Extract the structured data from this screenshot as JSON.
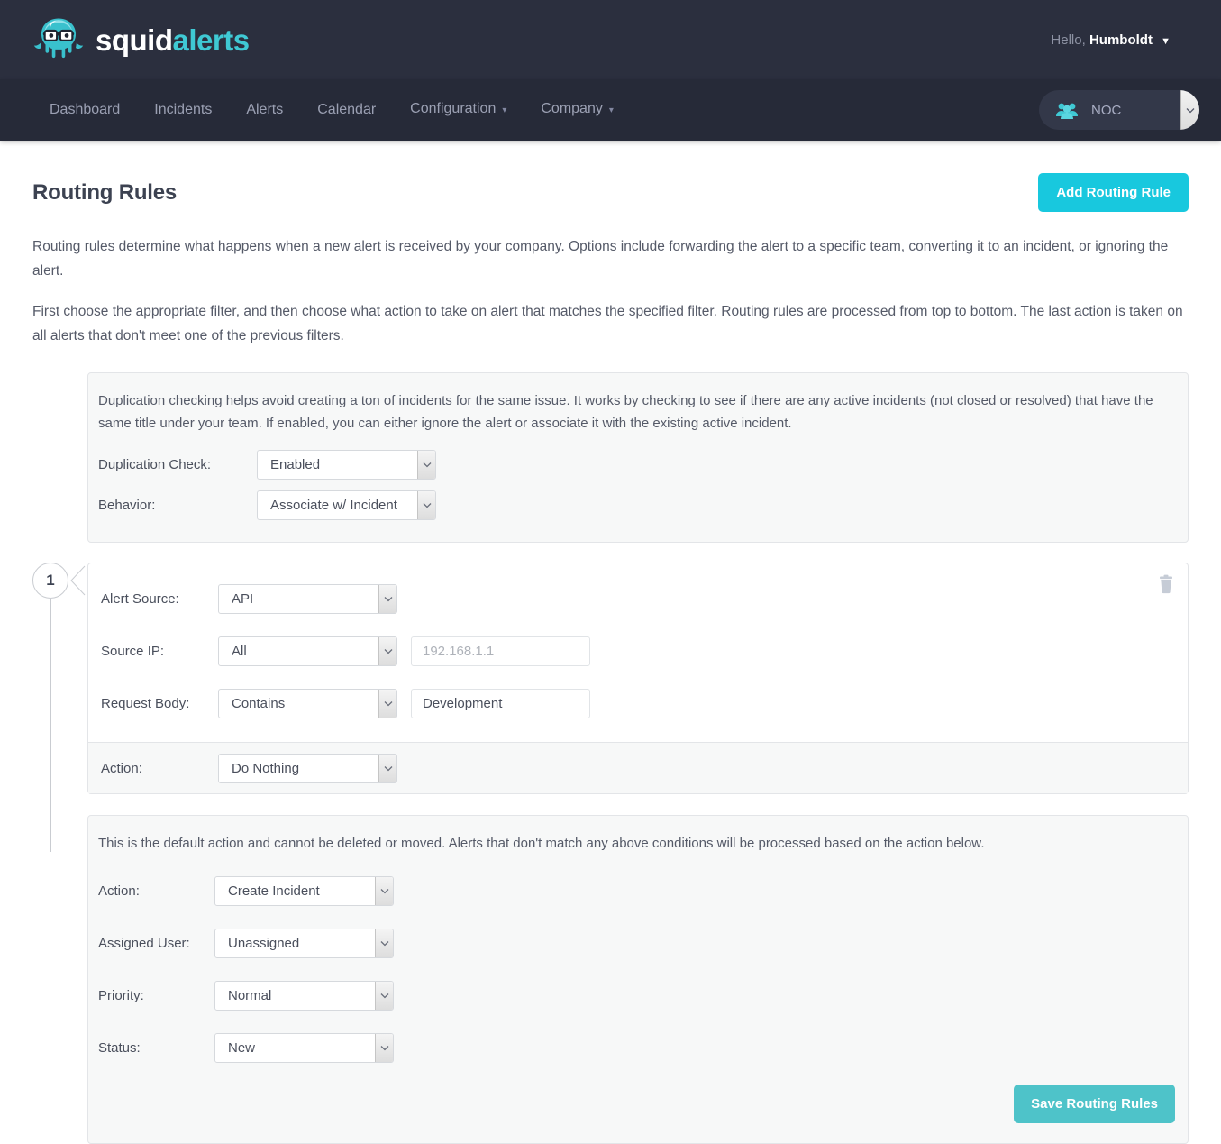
{
  "brand": {
    "word1": "squid",
    "word2": "alerts",
    "logo_icon": "squid-logo-icon"
  },
  "header": {
    "greeting_prefix": "Hello,",
    "user_name": "Humboldt",
    "caret_icon": "caret-down-icon"
  },
  "nav": {
    "items": [
      {
        "label": "Dashboard",
        "has_chevron": false
      },
      {
        "label": "Incidents",
        "has_chevron": false
      },
      {
        "label": "Alerts",
        "has_chevron": false
      },
      {
        "label": "Calendar",
        "has_chevron": false
      },
      {
        "label": "Configuration",
        "has_chevron": true
      },
      {
        "label": "Company",
        "has_chevron": true
      }
    ],
    "team_selector": {
      "value": "NOC",
      "icon": "people-group-icon"
    }
  },
  "page": {
    "title": "Routing Rules",
    "add_button": "Add Routing Rule",
    "intro_paragraph_1": "Routing rules determine what happens when a new alert is received by your company. Options include forwarding the alert to a specific team, converting it to an incident, or ignoring the alert.",
    "intro_paragraph_2": "First choose the appropriate filter, and then choose what action to take on alert that matches the specified filter. Routing rules are processed from top to bottom. The last action is taken on all alerts that don't meet one of the previous filters."
  },
  "duplication": {
    "note": "Duplication checking helps avoid creating a ton of incidents for the same issue. It works by checking to see if there are any active incidents (not closed or resolved) that have the same title under your team. If enabled, you can either ignore the alert or associate it with the existing active incident.",
    "check_label": "Duplication Check:",
    "check_value": "Enabled",
    "behavior_label": "Behavior:",
    "behavior_value": "Associate w/ Incident"
  },
  "rule": {
    "number": "1",
    "delete_icon": "trash-icon",
    "alert_source_label": "Alert Source:",
    "alert_source_value": "API",
    "source_ip_label": "Source IP:",
    "source_ip_value": "All",
    "source_ip_placeholder": "192.168.1.1",
    "request_body_label": "Request Body:",
    "request_body_value": "Contains",
    "request_body_text": "Development",
    "action_label": "Action:",
    "action_value": "Do Nothing"
  },
  "default_action": {
    "note": "This is the default action and cannot be deleted or moved. Alerts that don't match any above conditions will be processed based on the action below.",
    "action_label": "Action:",
    "action_value": "Create Incident",
    "assigned_user_label": "Assigned User:",
    "assigned_user_value": "Unassigned",
    "priority_label": "Priority:",
    "priority_value": "Normal",
    "status_label": "Status:",
    "status_value": "New",
    "save_button": "Save Routing Rules"
  },
  "colors": {
    "topbar": "#2b2f3e",
    "navbar": "#262a38",
    "brand_accent": "#3fc9d4",
    "add_button": "#18c8de",
    "save_button": "#4ec3c9"
  }
}
